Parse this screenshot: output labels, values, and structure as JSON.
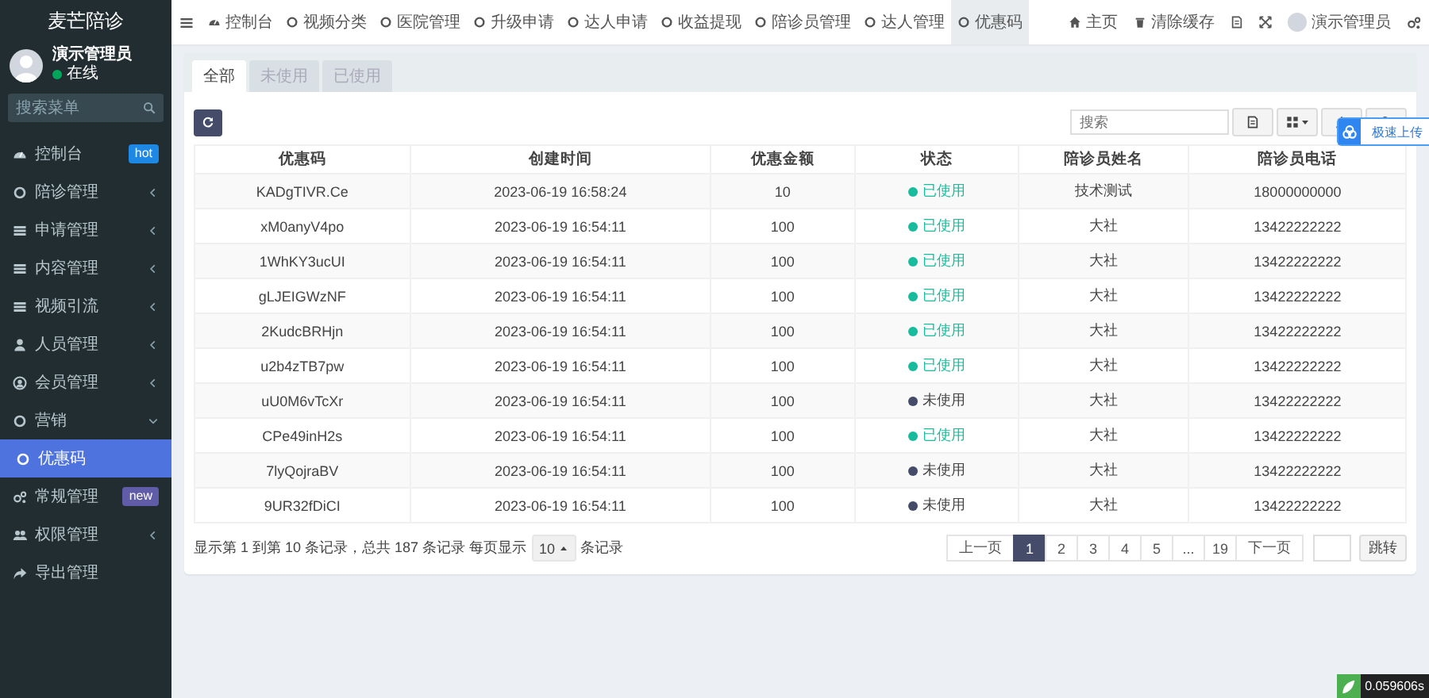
{
  "sidebar": {
    "logo": "麦芒陪诊",
    "user": {
      "name": "演示管理员",
      "status": "在线"
    },
    "search": {
      "placeholder": "搜索菜单"
    },
    "items": [
      {
        "label": "控制台",
        "badge": {
          "text": "hot",
          "color": "#1e88e5"
        },
        "selected": false
      },
      {
        "label": "陪诊管理",
        "expanded": false,
        "selected": false
      },
      {
        "label": "申请管理",
        "expanded": false,
        "selected": false
      },
      {
        "label": "内容管理",
        "expanded": false,
        "selected": false
      },
      {
        "label": "视频引流",
        "expanded": false,
        "selected": false
      },
      {
        "label": "人员管理",
        "expanded": false,
        "selected": false
      },
      {
        "label": "会员管理",
        "expanded": false,
        "selected": false
      },
      {
        "label": "营销",
        "expanded": true,
        "selected": false,
        "children": [
          {
            "label": "优惠码",
            "selected": true
          }
        ]
      },
      {
        "label": "常规管理",
        "badge": {
          "text": "new",
          "color": "#605ca8"
        },
        "selected": false
      },
      {
        "label": "权限管理",
        "expanded": false,
        "selected": false
      },
      {
        "label": "导出管理",
        "selected": false
      }
    ]
  },
  "topbar": {
    "tabs": [
      {
        "label": "控制台",
        "selected": false
      },
      {
        "label": "视频分类",
        "selected": false
      },
      {
        "label": "医院管理",
        "selected": false
      },
      {
        "label": "升级申请",
        "selected": false
      },
      {
        "label": "达人申请",
        "selected": false
      },
      {
        "label": "收益提现",
        "selected": false
      },
      {
        "label": "陪诊员管理",
        "selected": false
      },
      {
        "label": "达人管理",
        "selected": false
      },
      {
        "label": "优惠码",
        "selected": true
      }
    ],
    "home": "主页",
    "clear_cache": "清除缓存",
    "admin": "演示管理员"
  },
  "panel": {
    "tabs": [
      {
        "label": "全部",
        "selected": true
      },
      {
        "label": "未使用",
        "selected": false
      },
      {
        "label": "已使用",
        "selected": false
      }
    ],
    "search": {
      "placeholder": "搜索"
    },
    "table": {
      "columns": [
        "优惠码",
        "创建时间",
        "优惠金额",
        "状态",
        "陪诊员姓名",
        "陪诊员电话"
      ],
      "rows": [
        {
          "code": "KADgTIVR.Ce",
          "created": "2023-06-19 16:58:24",
          "amount": "10",
          "status": "已使用",
          "used": true,
          "name": "技术测试",
          "phone": "18000000000"
        },
        {
          "code": "xM0anyV4po",
          "created": "2023-06-19 16:54:11",
          "amount": "100",
          "status": "已使用",
          "used": true,
          "name": "大社",
          "phone": "13422222222"
        },
        {
          "code": "1WhKY3ucUI",
          "created": "2023-06-19 16:54:11",
          "amount": "100",
          "status": "已使用",
          "used": true,
          "name": "大社",
          "phone": "13422222222"
        },
        {
          "code": "gLJEIGWzNF",
          "created": "2023-06-19 16:54:11",
          "amount": "100",
          "status": "已使用",
          "used": true,
          "name": "大社",
          "phone": "13422222222"
        },
        {
          "code": "2KudcBRHjn",
          "created": "2023-06-19 16:54:11",
          "amount": "100",
          "status": "已使用",
          "used": true,
          "name": "大社",
          "phone": "13422222222"
        },
        {
          "code": "u2b4zTB7pw",
          "created": "2023-06-19 16:54:11",
          "amount": "100",
          "status": "已使用",
          "used": true,
          "name": "大社",
          "phone": "13422222222"
        },
        {
          "code": "uU0M6vTcXr",
          "created": "2023-06-19 16:54:11",
          "amount": "100",
          "status": "未使用",
          "used": false,
          "name": "大社",
          "phone": "13422222222"
        },
        {
          "code": "CPe49inH2s",
          "created": "2023-06-19 16:54:11",
          "amount": "100",
          "status": "已使用",
          "used": true,
          "name": "大社",
          "phone": "13422222222"
        },
        {
          "code": "7lyQojraBV",
          "created": "2023-06-19 16:54:11",
          "amount": "100",
          "status": "未使用",
          "used": false,
          "name": "大社",
          "phone": "13422222222"
        },
        {
          "code": "9UR32fDiCI",
          "created": "2023-06-19 16:54:11",
          "amount": "100",
          "status": "未使用",
          "used": false,
          "name": "大社",
          "phone": "13422222222"
        }
      ]
    },
    "summary": "显示第 1 到第 10 条记录，总共 187 条记录 每页显示",
    "page_size": "10",
    "page_size_suffix": "条记录",
    "pagination": {
      "prev": "上一页",
      "pages": [
        {
          "label": "1",
          "selected": true
        },
        {
          "label": "2",
          "selected": false
        },
        {
          "label": "3",
          "selected": false
        },
        {
          "label": "4",
          "selected": false
        },
        {
          "label": "5",
          "selected": false
        },
        {
          "label": "...",
          "selected": false
        },
        {
          "label": "19",
          "selected": false
        }
      ],
      "next": "下一页",
      "jump": "跳转"
    }
  },
  "upload_widget": {
    "label": "极速上传"
  },
  "timer_badge": "0.059606s"
}
